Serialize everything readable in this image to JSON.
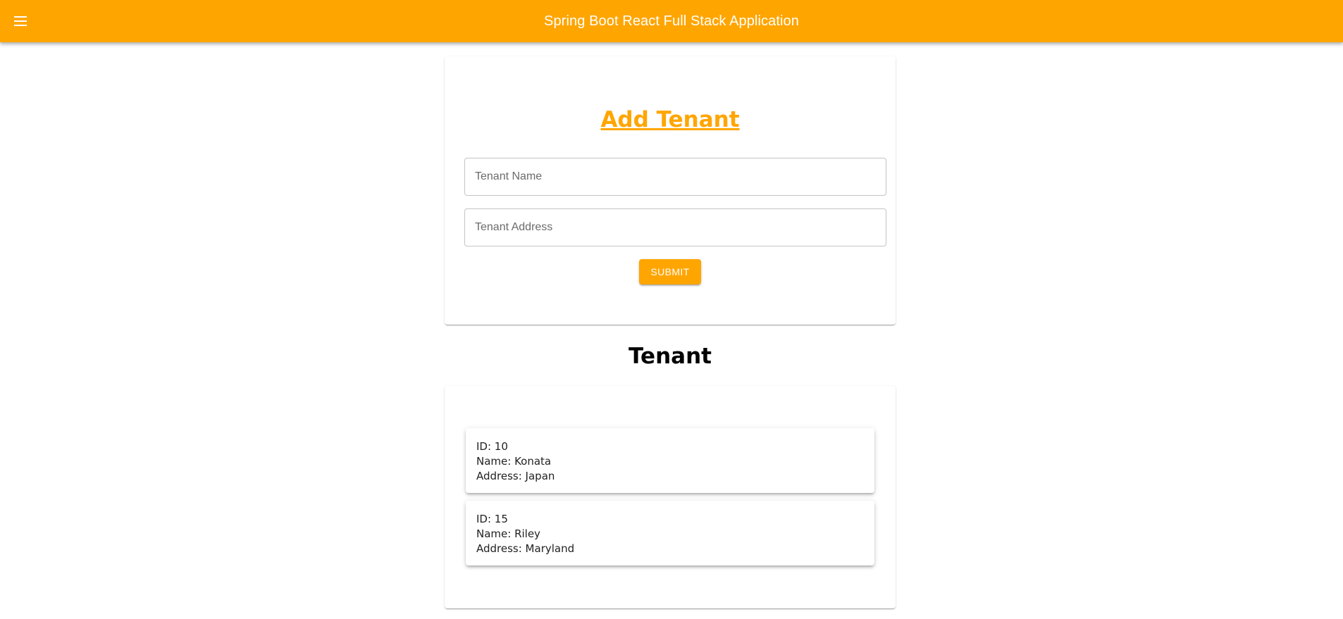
{
  "appbar": {
    "title": "Spring Boot React Full Stack Application",
    "menu_icon": "menu-icon",
    "color": "#ffa500"
  },
  "form": {
    "title": "Add Tenant",
    "name_placeholder": "Tenant Name",
    "address_placeholder": "Tenant Address",
    "submit_label": "SUBMIT"
  },
  "tenants_section": {
    "heading": "Tenant",
    "items": [
      {
        "id_line": "ID: 10",
        "name_line": "Name: Konata",
        "address_line": "Address: Japan"
      },
      {
        "id_line": "ID: 15",
        "name_line": "Name: Riley",
        "address_line": "Address: Maryland"
      }
    ]
  }
}
